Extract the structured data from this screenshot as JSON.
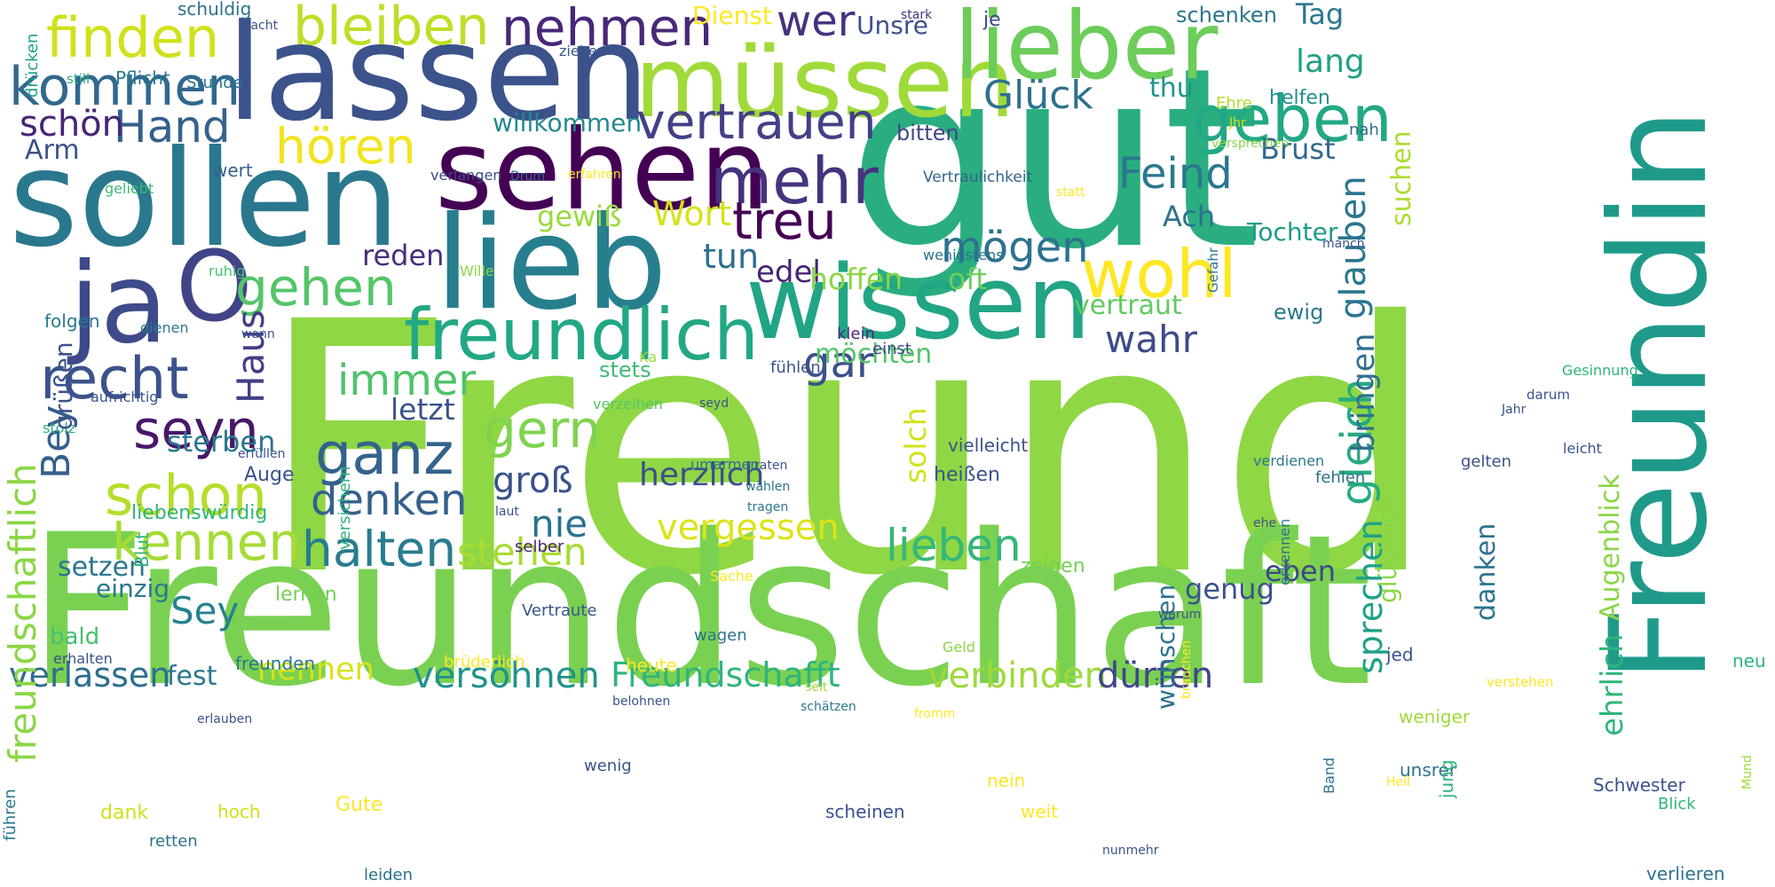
{
  "words": [
    {
      "text": "Freund",
      "color": "#8fd744"
    },
    {
      "text": "Freundschaft",
      "color": "#7ad151"
    },
    {
      "text": "gut",
      "color": "#2aae80"
    },
    {
      "text": "Freundin",
      "color": "#1f9a8a"
    },
    {
      "text": "sollen",
      "color": "#2a788e"
    },
    {
      "text": "lassen",
      "color": "#3b528b"
    },
    {
      "text": "lieb",
      "color": "#277f8e"
    },
    {
      "text": "sehen",
      "color": "#440154"
    },
    {
      "text": "wissen",
      "color": "#21a585"
    },
    {
      "text": "müssen",
      "color": "#a0da39"
    },
    {
      "text": "lieber",
      "color": "#6ccd5a"
    },
    {
      "text": "ja",
      "color": "#3e4a89"
    },
    {
      "text": "O",
      "color": "#414487"
    },
    {
      "text": "freundlich",
      "color": "#22a884"
    },
    {
      "text": "mehr",
      "color": "#46327e"
    },
    {
      "text": "wohl",
      "color": "#fde725"
    },
    {
      "text": "geben",
      "color": "#22a884"
    },
    {
      "text": "nehmen",
      "color": "#482878"
    },
    {
      "text": "bleiben",
      "color": "#bddf26"
    },
    {
      "text": "finden",
      "color": "#d0e11c"
    },
    {
      "text": "kommen",
      "color": "#31688e"
    },
    {
      "text": "vertrauen",
      "color": "#424086"
    },
    {
      "text": "treu",
      "color": "#440154"
    },
    {
      "text": "recht",
      "color": "#3b528b"
    },
    {
      "text": "seyn",
      "color": "#481769"
    },
    {
      "text": "ganz",
      "color": "#33638d"
    },
    {
      "text": "schon",
      "color": "#b5de2b"
    },
    {
      "text": "kennen",
      "color": "#a5db36"
    },
    {
      "text": "halten",
      "color": "#287d8e"
    },
    {
      "text": "gehen",
      "color": "#54c568"
    },
    {
      "text": "hören",
      "color": "#f1e51d"
    },
    {
      "text": "Hand",
      "color": "#34618d"
    },
    {
      "text": "wer",
      "color": "#46327e"
    },
    {
      "text": "mögen",
      "color": "#2c728e"
    },
    {
      "text": "wahr",
      "color": "#3e4a89"
    },
    {
      "text": "Feind",
      "color": "#2a788e"
    },
    {
      "text": "gern",
      "color": "#7fd34e"
    },
    {
      "text": "denken",
      "color": "#35608d"
    },
    {
      "text": "immer",
      "color": "#4ec36b"
    },
    {
      "text": "lieben",
      "color": "#35b779"
    },
    {
      "text": "stehen",
      "color": "#a8db34"
    },
    {
      "text": "verlassen",
      "color": "#2e6e8e"
    },
    {
      "text": "versöhnen",
      "color": "#20928c"
    },
    {
      "text": "Freundschafft",
      "color": "#2fb47c"
    },
    {
      "text": "verbinden",
      "color": "#9dd93b"
    },
    {
      "text": "dürfen",
      "color": "#3f4788"
    },
    {
      "text": "groß",
      "color": "#3b528b"
    },
    {
      "text": "nie",
      "color": "#2c728e"
    },
    {
      "text": "Glück",
      "color": "#2d708e"
    },
    {
      "text": "lang",
      "color": "#1fa088"
    },
    {
      "text": "Brust",
      "color": "#31688e"
    },
    {
      "text": "glauben",
      "color": "#2a768e"
    },
    {
      "text": "suchen",
      "color": "#addc30"
    },
    {
      "text": "gleich",
      "color": "#25ab82"
    },
    {
      "text": "Ach",
      "color": "#2c728e"
    },
    {
      "text": "Tochter",
      "color": "#1e9b8a"
    },
    {
      "text": "schön",
      "color": "#482475"
    },
    {
      "text": "Arm",
      "color": "#3b528b"
    },
    {
      "text": "Bey",
      "color": "#355f8d"
    },
    {
      "text": "Haus",
      "color": "#433e85"
    },
    {
      "text": "Sey",
      "color": "#26828e"
    },
    {
      "text": "setzen",
      "color": "#2b758e"
    },
    {
      "text": "nennen",
      "color": "#d8e219"
    },
    {
      "text": "fest",
      "color": "#2a778e"
    },
    {
      "text": "herzlich",
      "color": "#3d4e8a"
    },
    {
      "text": "vergessen",
      "color": "#dde318"
    },
    {
      "text": "gewiß",
      "color": "#9bd93c"
    },
    {
      "text": "Wort",
      "color": "#d5e21a"
    },
    {
      "text": "tun",
      "color": "#2d708e"
    },
    {
      "text": "edel",
      "color": "#482374"
    },
    {
      "text": "reden",
      "color": "#472d7b"
    },
    {
      "text": "hoffen",
      "color": "#8bd646"
    },
    {
      "text": "oft",
      "color": "#6ece58"
    },
    {
      "text": "vertraut",
      "color": "#60ca60"
    },
    {
      "text": "gar",
      "color": "#3c4f8a"
    },
    {
      "text": "möchten",
      "color": "#54c568"
    },
    {
      "text": "letzt",
      "color": "#3b528b"
    },
    {
      "text": "solch",
      "color": "#d2e21b"
    },
    {
      "text": "genug",
      "color": "#3b528b"
    },
    {
      "text": "eben",
      "color": "#3f4788"
    },
    {
      "text": "sprechen",
      "color": "#1fa188"
    },
    {
      "text": "bringen",
      "color": "#2e6f8e"
    },
    {
      "text": "willkommen",
      "color": "#23898e"
    },
    {
      "text": "Tag",
      "color": "#2a788e"
    },
    {
      "text": "schenken",
      "color": "#2a768e"
    },
    {
      "text": "thu",
      "color": "#1f948c"
    },
    {
      "text": "Unsre",
      "color": "#3b528b"
    },
    {
      "text": "Dienst",
      "color": "#fde725"
    },
    {
      "text": "je",
      "color": "#404688"
    },
    {
      "text": "bitten",
      "color": "#404688"
    },
    {
      "text": "helfen",
      "color": "#21908d"
    },
    {
      "text": "Ehre",
      "color": "#b2dd2d"
    },
    {
      "text": "nah",
      "color": "#2e6e8e"
    },
    {
      "text": "Pflicht",
      "color": "#2a788e"
    },
    {
      "text": "Stunde",
      "color": "#2c738e"
    },
    {
      "text": "still",
      "color": "#27ad81"
    },
    {
      "text": "drücken",
      "color": "#1fa188"
    },
    {
      "text": "schuldig",
      "color": "#2d708e"
    },
    {
      "text": "Nacht",
      "color": "#3b528b"
    },
    {
      "text": "stark",
      "color": "#46327e"
    },
    {
      "text": "ziehen",
      "color": "#3b528b"
    },
    {
      "text": "wert",
      "color": "#355f8d"
    },
    {
      "text": "geliebt",
      "color": "#3cbb75"
    },
    {
      "text": "verlangen",
      "color": "#3e4a89"
    },
    {
      "text": "Drum",
      "color": "#31688e"
    },
    {
      "text": "erfahren",
      "color": "#fde725"
    },
    {
      "text": "Vertraulichkeit",
      "color": "#33638d"
    },
    {
      "text": "statt",
      "color": "#fde725"
    },
    {
      "text": "versprechen",
      "color": "#86d549"
    },
    {
      "text": "Jhr",
      "color": "#d0e11c"
    },
    {
      "text": "ruhig",
      "color": "#46c06f"
    },
    {
      "text": "Wille",
      "color": "#8bd646"
    },
    {
      "text": "wenigstens",
      "color": "#2c728e"
    },
    {
      "text": "Gefahr",
      "color": "#2a778e"
    },
    {
      "text": "manch",
      "color": "#3b528b"
    },
    {
      "text": "klein",
      "color": "#482878"
    },
    {
      "text": "folgen",
      "color": "#2a788e"
    },
    {
      "text": "dienen",
      "color": "#2a788e"
    },
    {
      "text": "wann",
      "color": "#3b528b"
    },
    {
      "text": "ewig",
      "color": "#2a788e"
    },
    {
      "text": "stets",
      "color": "#3cbb75"
    },
    {
      "text": "einst",
      "color": "#404688"
    },
    {
      "text": "Ka",
      "color": "#a0da39"
    },
    {
      "text": "fühlen",
      "color": "#3b528b"
    },
    {
      "text": "Gesinnung",
      "color": "#2fb47c"
    },
    {
      "text": "darum",
      "color": "#3b528b"
    },
    {
      "text": "aufrichtig",
      "color": "#3b528b"
    },
    {
      "text": "verzeihen",
      "color": "#54c568"
    },
    {
      "text": "seyd",
      "color": "#3b528b"
    },
    {
      "text": "Jahr",
      "color": "#3b528b"
    },
    {
      "text": "stolz",
      "color": "#27ad81"
    },
    {
      "text": "erfüllen",
      "color": "#3b528b"
    },
    {
      "text": "vielleicht",
      "color": "#3b528b"
    },
    {
      "text": "umarmen",
      "color": "#2d708e"
    },
    {
      "text": "raten",
      "color": "#3b528b"
    },
    {
      "text": "verdienen",
      "color": "#2a788e"
    },
    {
      "text": "gelten",
      "color": "#3b528b"
    },
    {
      "text": "leicht",
      "color": "#3b528b"
    },
    {
      "text": "Auge",
      "color": "#3b528b"
    },
    {
      "text": "heißen",
      "color": "#3b528b"
    },
    {
      "text": "wählen",
      "color": "#2c728e"
    },
    {
      "text": "fehlen",
      "color": "#2c728e"
    },
    {
      "text": "tragen",
      "color": "#2a788e"
    },
    {
      "text": "liebenswürdig",
      "color": "#2fb47c"
    },
    {
      "text": "laut",
      "color": "#3b528b"
    },
    {
      "text": "ehe",
      "color": "#3b528b"
    },
    {
      "text": "erkennen",
      "color": "#2c728e"
    },
    {
      "text": "selber",
      "color": "#482878"
    },
    {
      "text": "Blut",
      "color": "#2fb47c"
    },
    {
      "text": "versichern",
      "color": "#2fb47c"
    },
    {
      "text": "einzig",
      "color": "#2a788e"
    },
    {
      "text": "lernen",
      "color": "#73d056"
    },
    {
      "text": "zeigen",
      "color": "#73d056"
    },
    {
      "text": "glücklich",
      "color": "#8bd646"
    },
    {
      "text": "Augenblick",
      "color": "#8bd646"
    },
    {
      "text": "ehrlich",
      "color": "#2fb47c"
    },
    {
      "text": "danken",
      "color": "#2c728e"
    },
    {
      "text": "wünschen",
      "color": "#2c728e"
    },
    {
      "text": "Sache",
      "color": "#fde725"
    },
    {
      "text": "Vertraute",
      "color": "#3b528b"
    },
    {
      "text": "warum",
      "color": "#3b528b"
    },
    {
      "text": "wagen",
      "color": "#2c728e"
    },
    {
      "text": "bald",
      "color": "#46c06f"
    },
    {
      "text": "erhalten",
      "color": "#3b528b"
    },
    {
      "text": "freunden",
      "color": "#2a788e"
    },
    {
      "text": "brüderlich",
      "color": "#fde725"
    },
    {
      "text": "heute",
      "color": "#fde725"
    },
    {
      "text": "Geld",
      "color": "#8bd646"
    },
    {
      "text": "brauchen",
      "color": "#fde725"
    },
    {
      "text": "jed",
      "color": "#3b528b"
    },
    {
      "text": "belohnen",
      "color": "#3b528b"
    },
    {
      "text": "seit",
      "color": "#a0da39"
    },
    {
      "text": "fromm",
      "color": "#fde725"
    },
    {
      "text": "schätzen",
      "color": "#2a788e"
    },
    {
      "text": "verstehen",
      "color": "#fde725"
    },
    {
      "text": "weniger",
      "color": "#a0da39"
    },
    {
      "text": "neu",
      "color": "#2fb47c"
    },
    {
      "text": "erlauben",
      "color": "#3b528b"
    },
    {
      "text": "wenig",
      "color": "#3b528b"
    },
    {
      "text": "unsrer",
      "color": "#2c728e"
    },
    {
      "text": "Heil",
      "color": "#fde725"
    },
    {
      "text": "Band",
      "color": "#2c728e"
    },
    {
      "text": "Schwester",
      "color": "#3b528b"
    },
    {
      "text": "Mund",
      "color": "#a0da39"
    },
    {
      "text": "Blick",
      "color": "#2fb47c"
    },
    {
      "text": "führen",
      "color": "#2a788e"
    },
    {
      "text": "dank",
      "color": "#d0e11c"
    },
    {
      "text": "hoch",
      "color": "#d0e11c"
    },
    {
      "text": "Gute",
      "color": "#fde725"
    },
    {
      "text": "nein",
      "color": "#fde725"
    },
    {
      "text": "weit",
      "color": "#fde725"
    },
    {
      "text": "jung",
      "color": "#2fb47c"
    },
    {
      "text": "scheinen",
      "color": "#3b528b"
    },
    {
      "text": "retten",
      "color": "#2c728e"
    },
    {
      "text": "leiden",
      "color": "#2c728e"
    },
    {
      "text": "nunmehr",
      "color": "#3b528b"
    },
    {
      "text": "verlieren",
      "color": "#2c728e"
    },
    {
      "text": "freundschaftlich",
      "color": "#8bd646"
    },
    {
      "text": "grüßen",
      "color": "#3b528b"
    },
    {
      "text": "sterben",
      "color": "#2a788e"
    }
  ]
}
